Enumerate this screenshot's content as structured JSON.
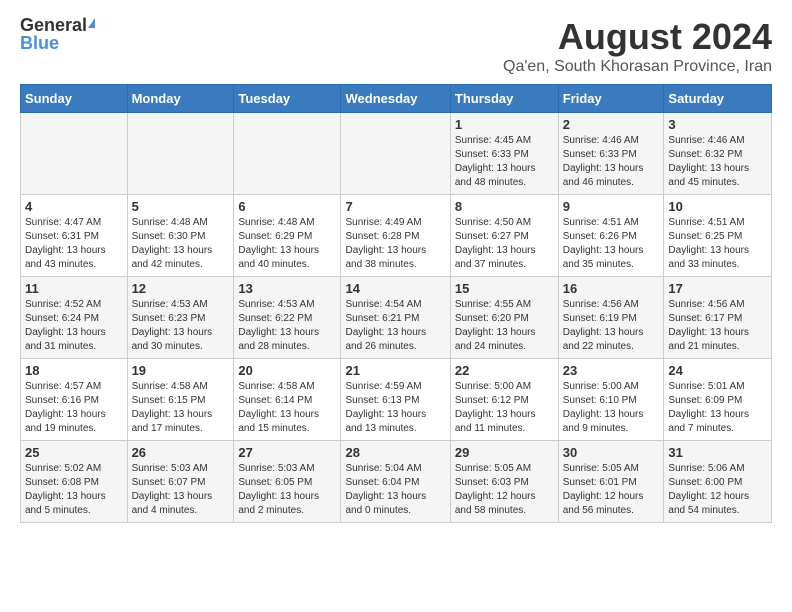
{
  "logo": {
    "general": "General",
    "blue": "Blue"
  },
  "title": {
    "month_year": "August 2024",
    "location": "Qa'en, South Khorasan Province, Iran"
  },
  "headers": [
    "Sunday",
    "Monday",
    "Tuesday",
    "Wednesday",
    "Thursday",
    "Friday",
    "Saturday"
  ],
  "weeks": [
    [
      {
        "day": "",
        "info": ""
      },
      {
        "day": "",
        "info": ""
      },
      {
        "day": "",
        "info": ""
      },
      {
        "day": "",
        "info": ""
      },
      {
        "day": "1",
        "info": "Sunrise: 4:45 AM\nSunset: 6:33 PM\nDaylight: 13 hours\nand 48 minutes."
      },
      {
        "day": "2",
        "info": "Sunrise: 4:46 AM\nSunset: 6:33 PM\nDaylight: 13 hours\nand 46 minutes."
      },
      {
        "day": "3",
        "info": "Sunrise: 4:46 AM\nSunset: 6:32 PM\nDaylight: 13 hours\nand 45 minutes."
      }
    ],
    [
      {
        "day": "4",
        "info": "Sunrise: 4:47 AM\nSunset: 6:31 PM\nDaylight: 13 hours\nand 43 minutes."
      },
      {
        "day": "5",
        "info": "Sunrise: 4:48 AM\nSunset: 6:30 PM\nDaylight: 13 hours\nand 42 minutes."
      },
      {
        "day": "6",
        "info": "Sunrise: 4:48 AM\nSunset: 6:29 PM\nDaylight: 13 hours\nand 40 minutes."
      },
      {
        "day": "7",
        "info": "Sunrise: 4:49 AM\nSunset: 6:28 PM\nDaylight: 13 hours\nand 38 minutes."
      },
      {
        "day": "8",
        "info": "Sunrise: 4:50 AM\nSunset: 6:27 PM\nDaylight: 13 hours\nand 37 minutes."
      },
      {
        "day": "9",
        "info": "Sunrise: 4:51 AM\nSunset: 6:26 PM\nDaylight: 13 hours\nand 35 minutes."
      },
      {
        "day": "10",
        "info": "Sunrise: 4:51 AM\nSunset: 6:25 PM\nDaylight: 13 hours\nand 33 minutes."
      }
    ],
    [
      {
        "day": "11",
        "info": "Sunrise: 4:52 AM\nSunset: 6:24 PM\nDaylight: 13 hours\nand 31 minutes."
      },
      {
        "day": "12",
        "info": "Sunrise: 4:53 AM\nSunset: 6:23 PM\nDaylight: 13 hours\nand 30 minutes."
      },
      {
        "day": "13",
        "info": "Sunrise: 4:53 AM\nSunset: 6:22 PM\nDaylight: 13 hours\nand 28 minutes."
      },
      {
        "day": "14",
        "info": "Sunrise: 4:54 AM\nSunset: 6:21 PM\nDaylight: 13 hours\nand 26 minutes."
      },
      {
        "day": "15",
        "info": "Sunrise: 4:55 AM\nSunset: 6:20 PM\nDaylight: 13 hours\nand 24 minutes."
      },
      {
        "day": "16",
        "info": "Sunrise: 4:56 AM\nSunset: 6:19 PM\nDaylight: 13 hours\nand 22 minutes."
      },
      {
        "day": "17",
        "info": "Sunrise: 4:56 AM\nSunset: 6:17 PM\nDaylight: 13 hours\nand 21 minutes."
      }
    ],
    [
      {
        "day": "18",
        "info": "Sunrise: 4:57 AM\nSunset: 6:16 PM\nDaylight: 13 hours\nand 19 minutes."
      },
      {
        "day": "19",
        "info": "Sunrise: 4:58 AM\nSunset: 6:15 PM\nDaylight: 13 hours\nand 17 minutes."
      },
      {
        "day": "20",
        "info": "Sunrise: 4:58 AM\nSunset: 6:14 PM\nDaylight: 13 hours\nand 15 minutes."
      },
      {
        "day": "21",
        "info": "Sunrise: 4:59 AM\nSunset: 6:13 PM\nDaylight: 13 hours\nand 13 minutes."
      },
      {
        "day": "22",
        "info": "Sunrise: 5:00 AM\nSunset: 6:12 PM\nDaylight: 13 hours\nand 11 minutes."
      },
      {
        "day": "23",
        "info": "Sunrise: 5:00 AM\nSunset: 6:10 PM\nDaylight: 13 hours\nand 9 minutes."
      },
      {
        "day": "24",
        "info": "Sunrise: 5:01 AM\nSunset: 6:09 PM\nDaylight: 13 hours\nand 7 minutes."
      }
    ],
    [
      {
        "day": "25",
        "info": "Sunrise: 5:02 AM\nSunset: 6:08 PM\nDaylight: 13 hours\nand 5 minutes."
      },
      {
        "day": "26",
        "info": "Sunrise: 5:03 AM\nSunset: 6:07 PM\nDaylight: 13 hours\nand 4 minutes."
      },
      {
        "day": "27",
        "info": "Sunrise: 5:03 AM\nSunset: 6:05 PM\nDaylight: 13 hours\nand 2 minutes."
      },
      {
        "day": "28",
        "info": "Sunrise: 5:04 AM\nSunset: 6:04 PM\nDaylight: 13 hours\nand 0 minutes."
      },
      {
        "day": "29",
        "info": "Sunrise: 5:05 AM\nSunset: 6:03 PM\nDaylight: 12 hours\nand 58 minutes."
      },
      {
        "day": "30",
        "info": "Sunrise: 5:05 AM\nSunset: 6:01 PM\nDaylight: 12 hours\nand 56 minutes."
      },
      {
        "day": "31",
        "info": "Sunrise: 5:06 AM\nSunset: 6:00 PM\nDaylight: 12 hours\nand 54 minutes."
      }
    ]
  ]
}
